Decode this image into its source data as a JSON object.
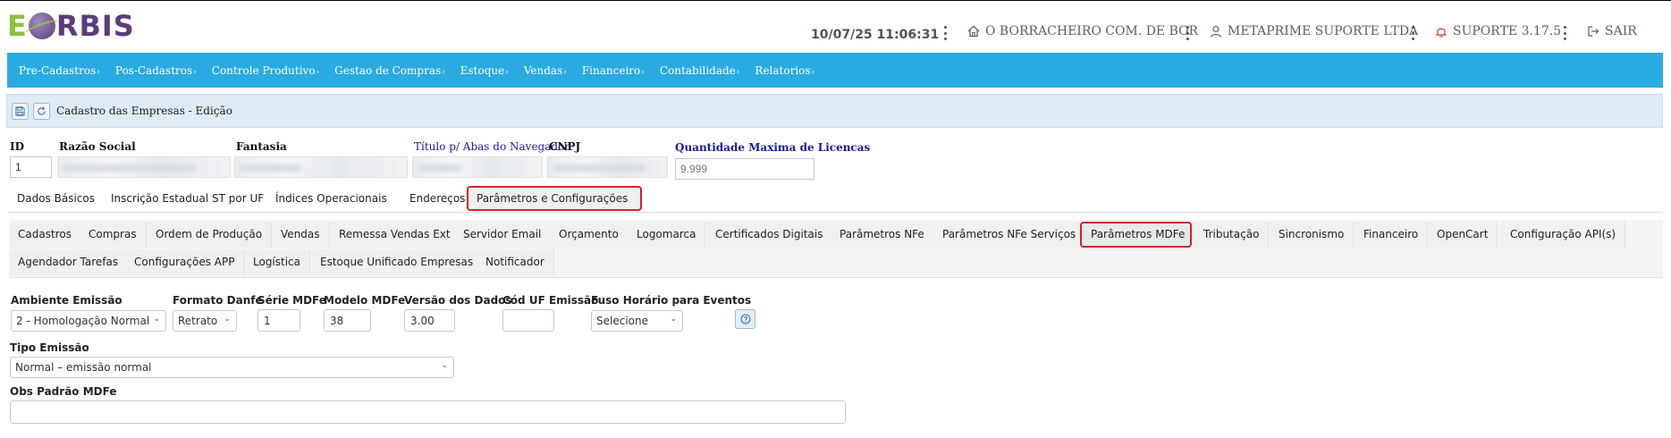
{
  "header": {
    "logo_prefix": "E",
    "logo_rest": "RBIS",
    "datetime": "10/07/25 11:06:31",
    "company": "O BORRACHEIRO COM. DE BOR",
    "user": "METAPRIME SUPORTE LTDA",
    "support": "SUPORTE 3.17.5",
    "logout": "SAIR"
  },
  "nav": {
    "items": [
      "Pre-Cadastros",
      "Pos-Cadastros",
      "Controle Produtivo",
      "Gestao de Compras",
      "Estoque",
      "Vendas",
      "Financeiro",
      "Contabilidade",
      "Relatorios"
    ]
  },
  "titlebar": {
    "title": "Cadastro das Empresas - Edição"
  },
  "company_form": {
    "id_label": "ID",
    "id_value": "1",
    "razao_label": "Razão Social",
    "fantasia_label": "Fantasia",
    "titulo_label": "Título p/ Abas do Navegador",
    "cnpj_label": "CNPJ",
    "licencas_label": "Quantidade Maxima de Licencas",
    "licencas_placeholder": "9.999"
  },
  "tabs": [
    "Dados Básicos",
    "Inscrição Estadual ST por UF",
    "Índices Operacionais",
    "Endereços",
    "Parâmetros e Configurações"
  ],
  "subtabs_row1": [
    "Cadastros",
    "Compras",
    "Ordem de Produção",
    "Vendas",
    "Remessa Vendas Ext",
    "Servidor Email",
    "Orçamento",
    "Logomarca",
    "Certificados Digitais",
    "Parâmetros NFe",
    "Parâmetros NFe Serviços",
    "Parâmetros MDFe",
    "Tributação",
    "Sincronismo",
    "Financeiro",
    "OpenCart",
    "Configuração API(s)"
  ],
  "subtabs_row2": [
    "Agendador Tarefas",
    "Configurações APP",
    "Logística",
    "Estoque Unificado Empresas",
    "Notificador"
  ],
  "mdfe_form": {
    "ambiente_label": "Ambiente Emissão",
    "ambiente_value": "2 - Homologação Normal",
    "danfe_label": "Formato Danfe",
    "danfe_value": "Retrato",
    "serie_label": "Série MDFe",
    "serie_value": "1",
    "modelo_label": "Modelo MDFe",
    "modelo_value": "38",
    "versao_label": "Versão dos Dados",
    "versao_value": "3.00",
    "coduf_label": "Cód UF Emissão",
    "coduf_value": "",
    "fuso_label": "Fuso Horário para Eventos",
    "fuso_value": "Selecione",
    "tipo_label": "Tipo Emissão",
    "tipo_value": "Normal – emissão normal",
    "obs_label": "Obs Padrão MDFe",
    "obs_value": ""
  },
  "colors": {
    "nav_bg": "#29abe2",
    "highlight_border": "#d61f2a",
    "titlebar_bg": "#deeaf4",
    "logo_green": "#8fbf3f",
    "logo_purple": "#5a3d7a"
  }
}
